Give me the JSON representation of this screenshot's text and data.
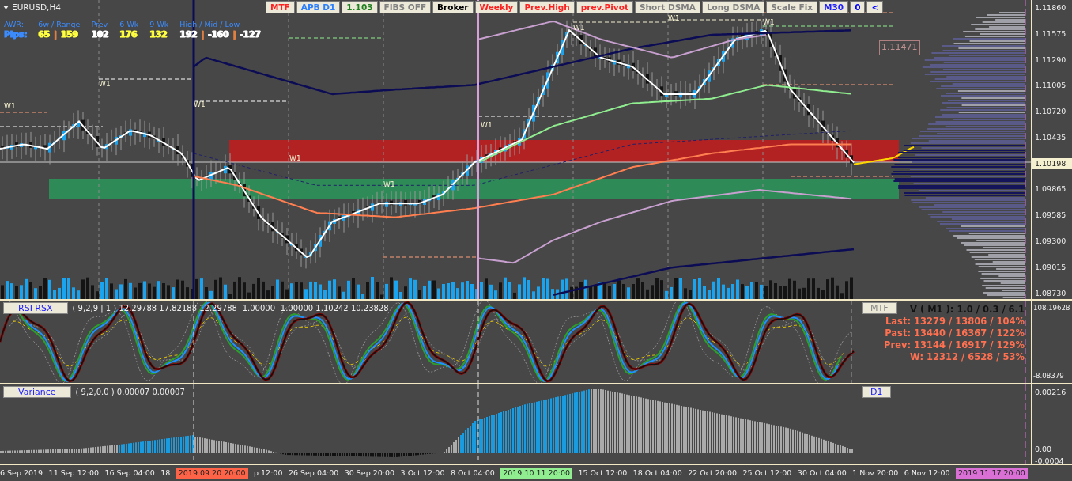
{
  "symbol": "EURUSD,H4",
  "awr": [
    {
      "header": "AWR:",
      "values": [
        {
          "text": "Pips:",
          "color": "#3c8cff"
        }
      ]
    },
    {
      "header": "6w / Range",
      "values": [
        {
          "text": "65",
          "color": "#ffff40"
        },
        {
          "text": "|",
          "color": "#e08040"
        },
        {
          "text": "159",
          "color": "#ffff40"
        }
      ]
    },
    {
      "header": "Prev",
      "values": [
        {
          "text": "102",
          "color": "#ffffff"
        }
      ]
    },
    {
      "header": "6-Wk",
      "values": [
        {
          "text": "176",
          "color": "#ffff40"
        }
      ]
    },
    {
      "header": "9-Wk",
      "values": [
        {
          "text": "132",
          "color": "#ffff40"
        }
      ]
    },
    {
      "header": "High / Mid / Low",
      "values": [
        {
          "text": "192",
          "color": "#ffffff"
        },
        {
          "text": "|",
          "color": "#e08040"
        },
        {
          "text": "-160",
          "color": "#ffffff"
        },
        {
          "text": "|",
          "color": "#e08040"
        },
        {
          "text": "-127",
          "color": "#ffffff"
        }
      ]
    }
  ],
  "toolbar": [
    {
      "label": "MTF",
      "color": "#ff2020"
    },
    {
      "label": "APB D1",
      "color": "#2a7fff"
    },
    {
      "label": "1.103",
      "color": "#208020"
    },
    {
      "label": "FIBS OFF",
      "color": "#808080"
    },
    {
      "label": "Broker",
      "color": "#000000"
    },
    {
      "label": "Weekly",
      "color": "#ff2020"
    },
    {
      "label": "Prev.High",
      "color": "#ff2020"
    },
    {
      "label": "prev.Pivot",
      "color": "#ff2020"
    },
    {
      "label": "Short DSMA",
      "color": "#808080"
    },
    {
      "label": "Long DSMA",
      "color": "#808080"
    },
    {
      "label": "Scale Fix",
      "color": "#808080"
    },
    {
      "label": "M30",
      "color": "#2020ff"
    },
    {
      "label": "0",
      "color": "#0000ff"
    },
    {
      "label": "<",
      "color": "#0000ff"
    }
  ],
  "week_labels": [
    {
      "text": "W1"
    },
    {
      "text": "W1"
    },
    {
      "text": "W1"
    },
    {
      "text": "W1"
    },
    {
      "text": "W1"
    },
    {
      "text": "W1"
    },
    {
      "text": "W1"
    },
    {
      "text": "W1"
    },
    {
      "text": "W1"
    }
  ],
  "price_box": "1.11471",
  "price_axis": {
    "ticks_above": [
      "1.11860",
      "1.11575",
      "1.11290",
      "1.11005",
      "1.10720",
      "1.10435"
    ],
    "current": "1.10198",
    "ticks_below": [
      "1.09865",
      "1.09585",
      "1.09300",
      "1.09015",
      "1.08730"
    ]
  },
  "rsi_panel": {
    "title": "RSI RSX",
    "params": "( 9,2,9 | 1 ) 12.29788 17.82188 12.29788 -1.00000 -1.00000 1.10242 10.23828",
    "button": "MTF",
    "stats": [
      {
        "text": "V ( M1 ): 1.0 / 0.3 / 6.1",
        "color": "#111111"
      },
      {
        "text": "Last: 13279 / 13806 / 104%",
        "color": "#ff7050"
      },
      {
        "text": "Past: 13440 / 16367 / 122%",
        "color": "#ff7050"
      },
      {
        "text": "Prev: 13144 / 16917 / 129%",
        "color": "#ff7050"
      },
      {
        "text": "W: 12312 / 6528 / 53%",
        "color": "#ff7050"
      }
    ],
    "axis": [
      "108.19628",
      "-8.08379"
    ]
  },
  "variance_panel": {
    "title": "Variance",
    "params": "( 9,2,0.0 ) 0.00007 0.00007",
    "button": "D1",
    "axis": [
      "0.00216",
      "0.00",
      "-0.0004"
    ]
  },
  "time_axis": [
    {
      "text": "6 Sep 2019",
      "kind": "tick"
    },
    {
      "text": "11 Sep 12:00",
      "kind": "tick"
    },
    {
      "text": "16 Sep 04:00",
      "kind": "tick"
    },
    {
      "text": "18",
      "kind": "tick"
    },
    {
      "text": "2019.09.20 20:00",
      "kind": "marker",
      "color": "#ff6347"
    },
    {
      "text": "p 12:00",
      "kind": "tick"
    },
    {
      "text": "26 Sep 04:00",
      "kind": "tick"
    },
    {
      "text": "30 Sep 20:00",
      "kind": "tick"
    },
    {
      "text": "3 Oct 12:00",
      "kind": "tick"
    },
    {
      "text": "8 Oct 04:00",
      "kind": "tick"
    },
    {
      "text": "2019.10.11 20:00",
      "kind": "marker",
      "color": "#90ee90"
    },
    {
      "text": "15 Oct 12:00",
      "kind": "tick"
    },
    {
      "text": "18 Oct 04:00",
      "kind": "tick"
    },
    {
      "text": "22 Oct 20:00",
      "kind": "tick"
    },
    {
      "text": "25 Oct 12:00",
      "kind": "tick"
    },
    {
      "text": "30 Oct 04:00",
      "kind": "tick"
    },
    {
      "text": "1 Nov 20:00",
      "kind": "tick"
    },
    {
      "text": "6 Nov 12:00",
      "kind": "tick"
    },
    {
      "text": "2019.11.17 20:00",
      "kind": "marker",
      "color": "#da70d6"
    }
  ]
}
